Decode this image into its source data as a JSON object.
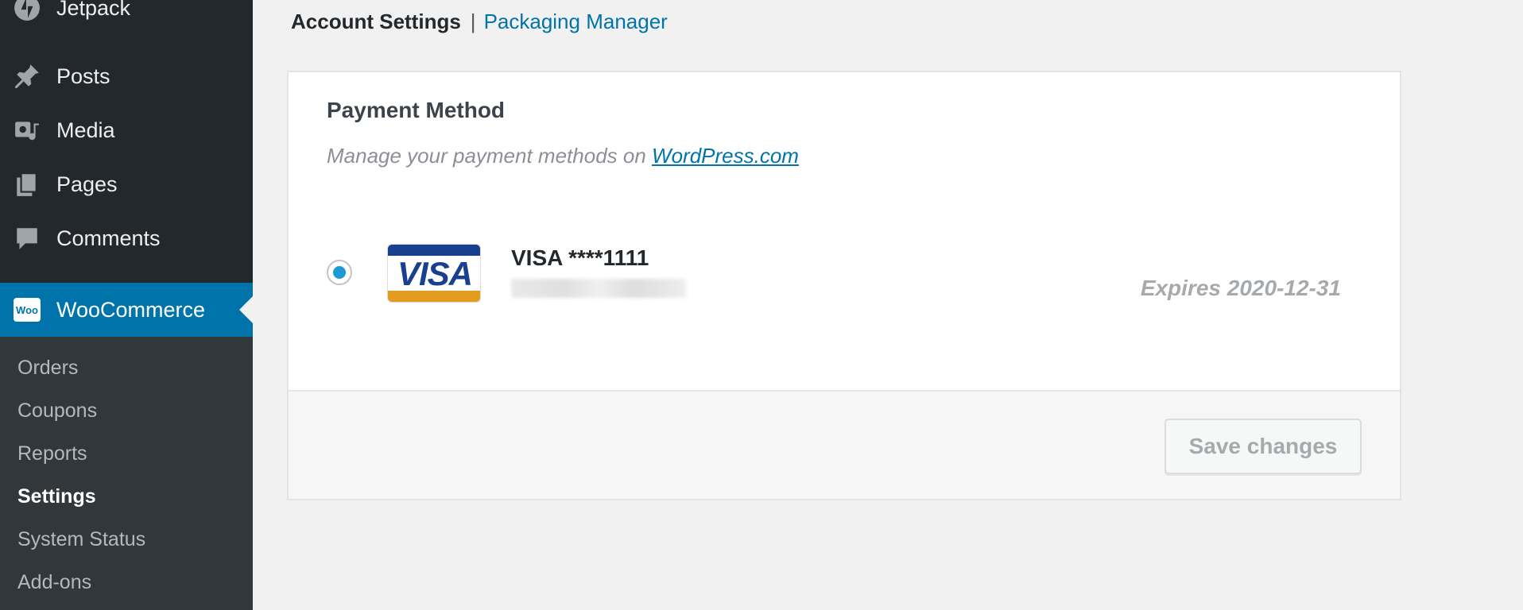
{
  "sidebar": {
    "menu": [
      {
        "label": "Jetpack",
        "icon": "jetpack-icon"
      },
      {
        "label": "Posts",
        "icon": "pin-icon"
      },
      {
        "label": "Media",
        "icon": "media-icon"
      },
      {
        "label": "Pages",
        "icon": "pages-icon"
      },
      {
        "label": "Comments",
        "icon": "comment-icon"
      },
      {
        "label": "WooCommerce",
        "icon": "woo-icon"
      }
    ],
    "woo_icon_text": "Woo",
    "submenu": [
      {
        "label": "Orders"
      },
      {
        "label": "Coupons"
      },
      {
        "label": "Reports"
      },
      {
        "label": "Settings",
        "current": true
      },
      {
        "label": "System Status"
      },
      {
        "label": "Add-ons"
      }
    ]
  },
  "tabs": {
    "current": "Account Settings",
    "separator": "|",
    "link": "Packaging Manager"
  },
  "payment": {
    "title": "Payment Method",
    "description_prefix": "Manage your payment methods on ",
    "description_link": "WordPress.com",
    "card_brand": "VISA",
    "card_label": "VISA ****1111",
    "expires": "Expires 2020-12-31",
    "selected": true
  },
  "footer": {
    "save_label": "Save changes"
  },
  "colors": {
    "sidebar_bg": "#23282d",
    "active_bg": "#0073aa",
    "link": "#0073aa",
    "radio_selected": "#1a9bd6"
  }
}
